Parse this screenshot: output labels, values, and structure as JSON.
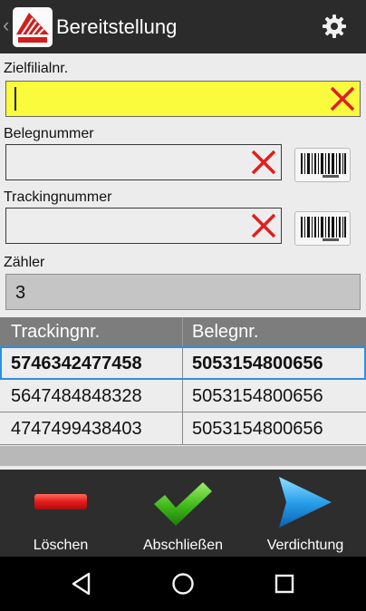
{
  "app": {
    "title": "Bereitstellung",
    "back_icon": "chevron-left-icon",
    "logo_icon": "app-logo-icon",
    "settings_icon": "gear-icon"
  },
  "form": {
    "target_branch": {
      "label": "Zielfilialnr.",
      "value": ""
    },
    "document_number": {
      "label": "Belegnummer",
      "value": ""
    },
    "tracking_number": {
      "label": "Trackingnummer",
      "value": ""
    },
    "counter": {
      "label": "Zähler",
      "value": "3"
    }
  },
  "table": {
    "headers": [
      "Trackingnr.",
      "Belegnr."
    ],
    "rows": [
      [
        "5746342477458",
        "5053154800656"
      ],
      [
        "5647484848328",
        "5053154800656"
      ],
      [
        "4747499438403",
        "5053154800656"
      ]
    ],
    "selected_row": 0
  },
  "actions": [
    {
      "label": "Löschen",
      "icon": "minus-icon"
    },
    {
      "label": "Abschließen",
      "icon": "checkmark-icon"
    },
    {
      "label": "Verdichtung",
      "icon": "play-arrow-icon"
    }
  ],
  "colors": {
    "appbar": "#2b2b2b",
    "active_field": "#fbfb3e",
    "clear_x": "#e01f1f",
    "selection": "#2e8fe3",
    "delete": "#e51a1a",
    "confirm": "#3fb81a",
    "proceed": "#2aa0ea"
  },
  "navigation": [
    "back-icon",
    "home-icon",
    "recents-icon"
  ]
}
